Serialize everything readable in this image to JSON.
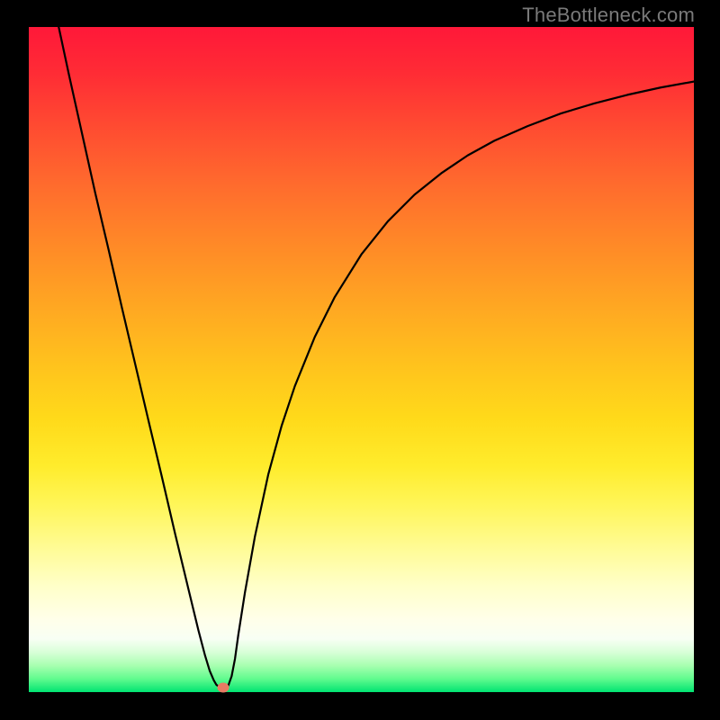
{
  "watermark": "TheBottleneck.com",
  "chart_data": {
    "type": "line",
    "title": "",
    "xlabel": "",
    "ylabel": "",
    "xlim": [
      0,
      100
    ],
    "ylim": [
      0,
      100
    ],
    "grid": false,
    "legend": false,
    "x": [
      4.5,
      6,
      8,
      10,
      12,
      14,
      16,
      18,
      20,
      22,
      24,
      25.5,
      26.5,
      27.2,
      27.8,
      28.2,
      28.6,
      29,
      29.5,
      30,
      30.5,
      31,
      31.5,
      32.5,
      34,
      36,
      38,
      40,
      43,
      46,
      50,
      54,
      58,
      62,
      66,
      70,
      75,
      80,
      85,
      90,
      95,
      100
    ],
    "y": [
      100,
      93,
      84,
      75,
      66.5,
      57.8,
      49.3,
      40.8,
      32.4,
      23.8,
      15.5,
      9.3,
      5.5,
      3.2,
      1.8,
      1.1,
      0.8,
      0.7,
      0.7,
      1,
      2.4,
      5,
      8.6,
      15,
      23.4,
      32.7,
      40,
      46,
      53.4,
      59.4,
      65.8,
      70.8,
      74.8,
      78,
      80.7,
      82.9,
      85.1,
      87,
      88.5,
      89.8,
      90.9,
      91.8
    ],
    "min_point": {
      "x": 29.2,
      "y": 0.7
    },
    "stroke": "#000000",
    "stroke_width": 2.2,
    "min_dot_color": "#e77a63"
  },
  "colors": {
    "frame_bg": "#000000",
    "watermark_text": "#7a7a7a"
  }
}
